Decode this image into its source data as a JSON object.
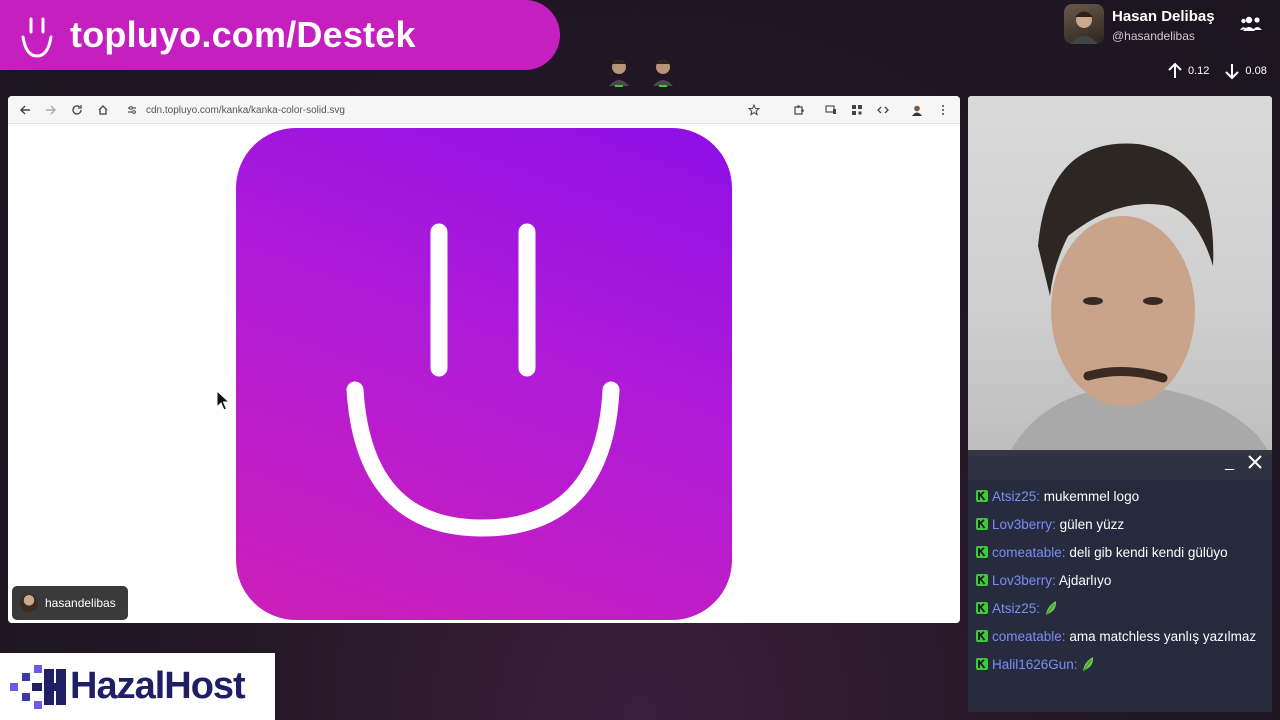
{
  "banner": {
    "text": "topluyo.com/Destek"
  },
  "user": {
    "name": "Hasan Delibaş",
    "handle": "@hasandelibas"
  },
  "stats": {
    "up": "0.12",
    "down": "0.08"
  },
  "browser": {
    "url": "cdn.topluyo.com/kanka/kanka-color-solid.svg"
  },
  "logo": {
    "gradient": [
      "#8d0fe6",
      "#b01bd8",
      "#cc1fb8"
    ]
  },
  "streamer_tag": {
    "name": "hasandelibas"
  },
  "chat": {
    "messages": [
      {
        "user": "Atsiz25:",
        "text": "mukemmel logo"
      },
      {
        "user": "Lov3berry:",
        "text": "gülen yüzz"
      },
      {
        "user": "comeatable:",
        "text": "deli gib kendi kendi gülüyo"
      },
      {
        "user": "Lov3berry:",
        "text": "Ajdarlıyo"
      },
      {
        "user": "Atsiz25:",
        "text": ""
      },
      {
        "user": "comeatable:",
        "text": "ama matchless yanlış yazılmaz"
      },
      {
        "user": "Halil1626Gun:",
        "text": ""
      }
    ]
  },
  "sponsor": {
    "name": "HazalHost"
  },
  "colors": {
    "banner": "#c61fbf",
    "chat_user": "#7c8cf6",
    "badge": "#3ec93a"
  }
}
